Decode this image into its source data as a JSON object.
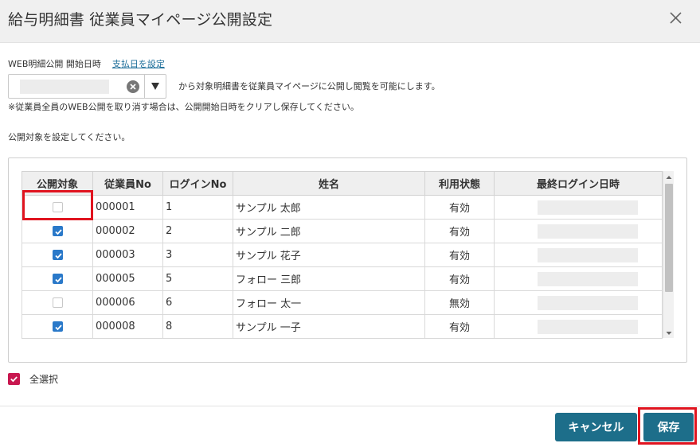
{
  "dialog": {
    "title": "給与明細書 従業員マイページ公開設定",
    "close_icon": "close-icon"
  },
  "publish": {
    "label": "WEB明細公開 開始日時",
    "link": "支払日を設定",
    "date_value": "",
    "description": "から対象明細書を従業員マイページに公開し閲覧を可能にします。",
    "note": "※従業員全員のWEB公開を取り消す場合は、公開開始日時をクリアし保存してください。",
    "target_label": "公開対象を設定してください。"
  },
  "table": {
    "headers": [
      "公開対象",
      "従業員No",
      "ログインNo",
      "姓名",
      "利用状態",
      "最終ログイン日時"
    ],
    "rows": [
      {
        "checked": false,
        "emp_no": "000001",
        "login_no": "1",
        "name": "サンプル 太郎",
        "status": "有効",
        "last_login": ""
      },
      {
        "checked": true,
        "emp_no": "000002",
        "login_no": "2",
        "name": "サンプル 二郎",
        "status": "有効",
        "last_login": ""
      },
      {
        "checked": true,
        "emp_no": "000003",
        "login_no": "3",
        "name": "サンプル 花子",
        "status": "有効",
        "last_login": ""
      },
      {
        "checked": true,
        "emp_no": "000005",
        "login_no": "5",
        "name": "フォロー 三郎",
        "status": "有効",
        "last_login": ""
      },
      {
        "checked": false,
        "emp_no": "000006",
        "login_no": "6",
        "name": "フォロー 太一",
        "status": "無効",
        "last_login": ""
      },
      {
        "checked": true,
        "emp_no": "000008",
        "login_no": "8",
        "name": "サンプル 一子",
        "status": "有効",
        "last_login": ""
      }
    ]
  },
  "select_all": {
    "label": "全選択",
    "checked": true
  },
  "buttons": {
    "cancel": "キャンセル",
    "save": "保存"
  },
  "colors": {
    "header_bg": "#f0f0f0",
    "button_bg": "#1d6e8a",
    "checkbox_on": "#2a79c9",
    "select_all": "#c8174f",
    "highlight": "#e0141f",
    "link": "#1b6d99"
  }
}
